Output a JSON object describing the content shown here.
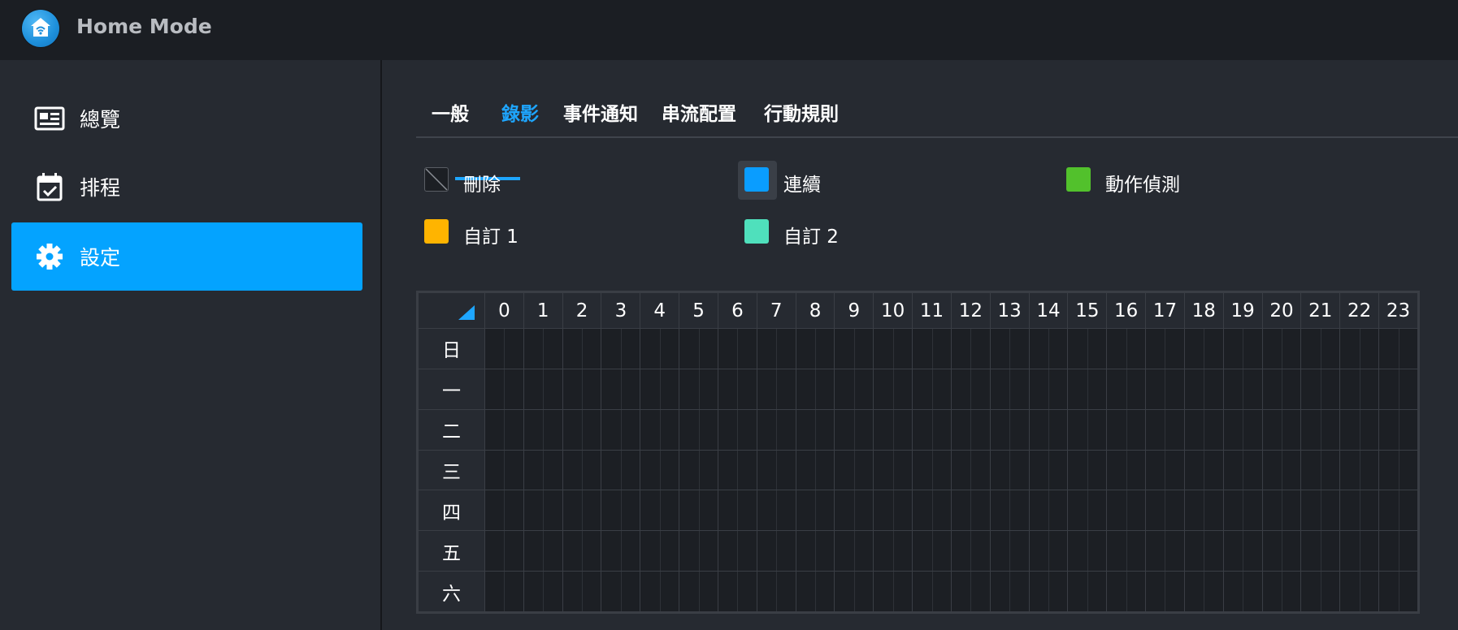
{
  "app": {
    "title": "Home Mode",
    "icon": "home-wifi-icon"
  },
  "sidebar": {
    "items": [
      {
        "label": "總覽",
        "icon": "overview-card-icon",
        "active": false
      },
      {
        "label": "排程",
        "icon": "calendar-check-icon",
        "active": false
      },
      {
        "label": "設定",
        "icon": "gear-icon",
        "active": true
      }
    ]
  },
  "tabs": [
    {
      "label": "一般",
      "active": false
    },
    {
      "label": "錄影",
      "active": true
    },
    {
      "label": "事件通知",
      "active": false
    },
    {
      "label": "串流配置",
      "active": false
    },
    {
      "label": "行動規則",
      "active": false
    }
  ],
  "legend": [
    {
      "label": "刪除",
      "color": "#1c1f24",
      "selected": false
    },
    {
      "label": "連續",
      "color": "#0a9dff",
      "selected": true
    },
    {
      "label": "動作偵測",
      "color": "#52c12c",
      "selected": false
    },
    {
      "label": "自訂 1",
      "color": "#ffb400",
      "selected": false
    },
    {
      "label": "自訂 2",
      "color": "#4fe0bc",
      "selected": false
    }
  ],
  "schedule": {
    "hours": [
      "0",
      "1",
      "2",
      "3",
      "4",
      "5",
      "6",
      "7",
      "8",
      "9",
      "10",
      "11",
      "12",
      "13",
      "14",
      "15",
      "16",
      "17",
      "18",
      "19",
      "20",
      "21",
      "22",
      "23"
    ],
    "days": [
      "日",
      "一",
      "二",
      "三",
      "四",
      "五",
      "六"
    ]
  },
  "colors": {
    "accent": "#04a3ff",
    "background": "#262a31",
    "titlebar": "#1b1e23"
  }
}
